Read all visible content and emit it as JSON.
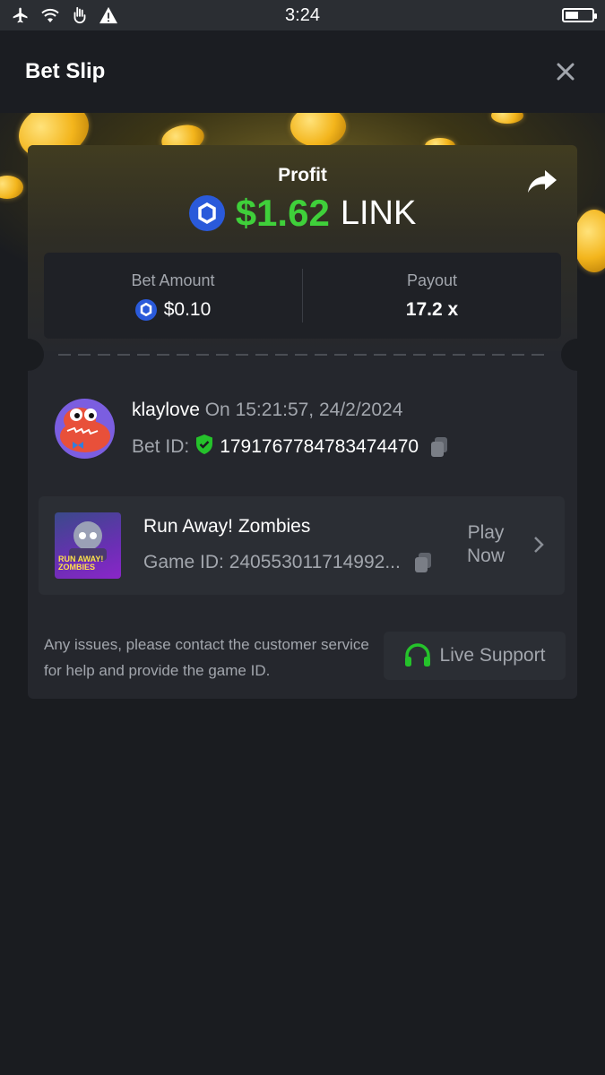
{
  "status_bar": {
    "time": "3:24",
    "icons": [
      "airplane-icon",
      "wifi-icon",
      "gesture-icon",
      "warning-icon"
    ],
    "battery_icon": "battery-icon"
  },
  "header": {
    "title": "Bet Slip",
    "close_icon": "close-icon"
  },
  "profit": {
    "label": "Profit",
    "amount": "$1.62",
    "currency": "LINK",
    "share_icon": "share-icon"
  },
  "stats": {
    "bet_amount_label": "Bet Amount",
    "bet_amount_value": "$0.10",
    "payout_label": "Payout",
    "payout_value": "17.2 x"
  },
  "user": {
    "username": "klaylove",
    "timestamp": "On 15:21:57, 24/2/2024",
    "bet_id_label": "Bet ID:",
    "bet_id": "1791767784783474470"
  },
  "game": {
    "name": "Run Away! Zombies",
    "game_id": "Game ID: 240553011714992...",
    "thumb_text": "RUN AWAY! ZOMBIES",
    "play_line1": "Play",
    "play_line2": "Now"
  },
  "footer": {
    "help_text": "Any issues, please contact the customer service for help and provide the game ID.",
    "live_support_label": "Live Support"
  },
  "colors": {
    "accent_green": "#3fd03a",
    "link_blue": "#2a5ada",
    "background": "#1a1c20",
    "card": "#25272d"
  }
}
